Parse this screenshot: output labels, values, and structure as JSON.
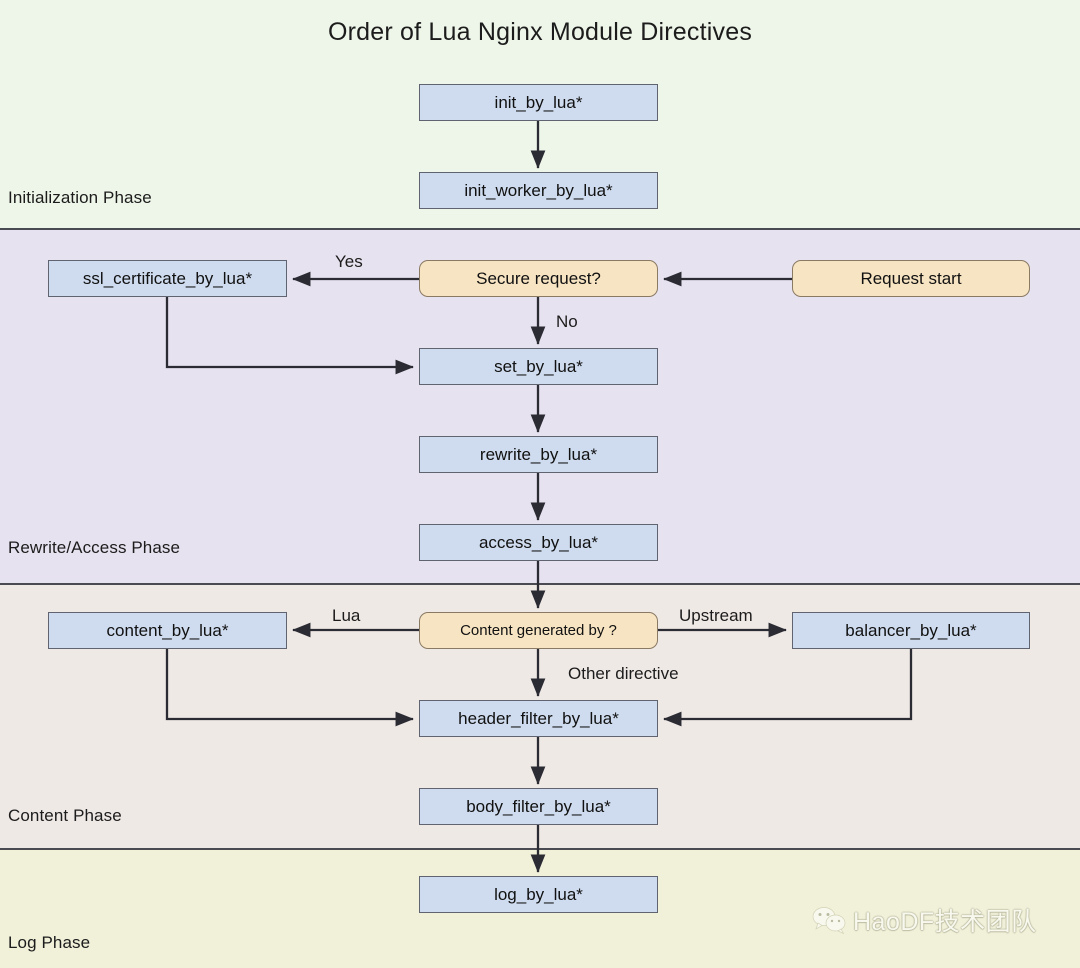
{
  "title": "Order of Lua Nginx Module Directives",
  "colors": {
    "init_band": "#eef6e9",
    "rewrite_band": "#e7e2ef",
    "content_band": "#efe9e6",
    "log_band": "#f1f1da",
    "directive_box": "#cfdcef",
    "decision_box": "#f7e4c3",
    "border": "#6b6b75",
    "separator": "#4a4a52",
    "edge": "#2b2b33",
    "text": "#1c1c1c"
  },
  "phases": [
    {
      "label": "Initialization Phase"
    },
    {
      "label": "Rewrite/Access Phase"
    },
    {
      "label": "Content Phase"
    },
    {
      "label": "Log Phase"
    }
  ],
  "nodes": {
    "init_by_lua": "init_by_lua*",
    "init_worker_by_lua": "init_worker_by_lua*",
    "request_start": "Request start",
    "secure_request": "Secure request?",
    "ssl_certificate_by_lua": "ssl_certificate_by_lua*",
    "set_by_lua": "set_by_lua*",
    "rewrite_by_lua": "rewrite_by_lua*",
    "access_by_lua": "access_by_lua*",
    "content_generated_by": "Content generated by ?",
    "content_by_lua": "content_by_lua*",
    "balancer_by_lua": "balancer_by_lua*",
    "header_filter_by_lua": "header_filter_by_lua*",
    "body_filter_by_lua": "body_filter_by_lua*",
    "log_by_lua": "log_by_lua*"
  },
  "edge_labels": {
    "yes": "Yes",
    "no": "No",
    "lua": "Lua",
    "upstream": "Upstream",
    "other_directive": "Other directive"
  },
  "watermark": {
    "icon": "wechat-icon",
    "text": "HaoDF技术团队"
  }
}
